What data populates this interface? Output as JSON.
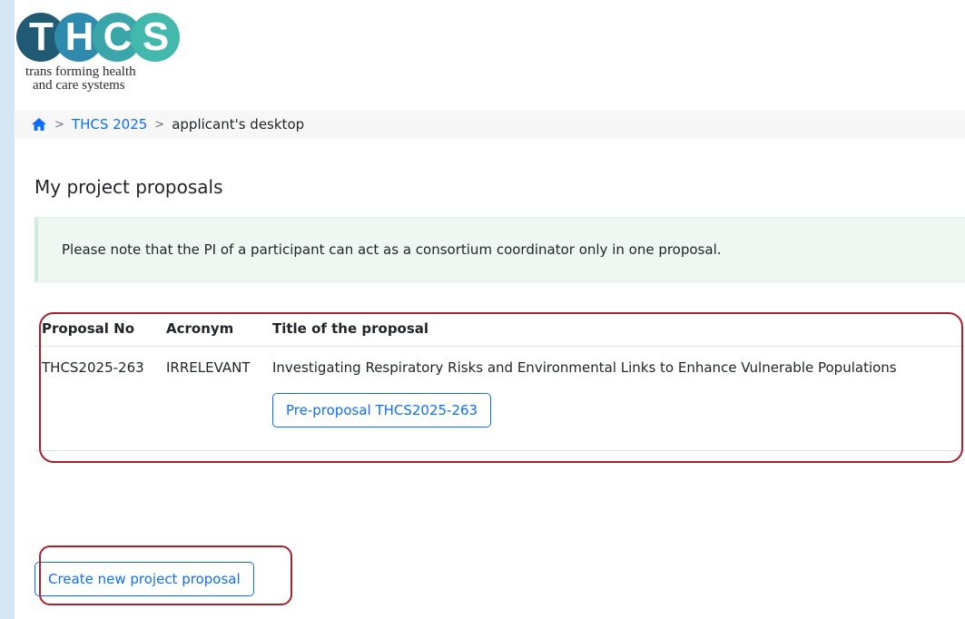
{
  "logo": {
    "letters": [
      "T",
      "H",
      "C",
      "S"
    ],
    "tagline_line1": "trans forming health",
    "tagline_line2": "and care systems"
  },
  "breadcrumb": {
    "home_icon": "home-icon",
    "separator": ">",
    "link": "THCS 2025",
    "current": "applicant's desktop"
  },
  "page": {
    "title": "My project proposals"
  },
  "alert": {
    "message": "Please note that the PI of a participant can act as a consortium coordinator only in one proposal."
  },
  "table": {
    "headers": [
      "Proposal No",
      "Acronym",
      "Title of the proposal"
    ],
    "rows": [
      {
        "proposal_no": "THCS2025-263",
        "acronym": "IRRELEVANT",
        "title": "Investigating Respiratory Risks and Environmental Links to Enhance Vulnerable Populations",
        "button": "Pre-proposal THCS2025-263"
      }
    ]
  },
  "actions": {
    "create": "Create new project proposal"
  },
  "colors": {
    "link": "#0d6efd",
    "highlight": "#a8212b",
    "alert_bg": "#eef7f2",
    "side_bg": "#d6e6f5"
  }
}
